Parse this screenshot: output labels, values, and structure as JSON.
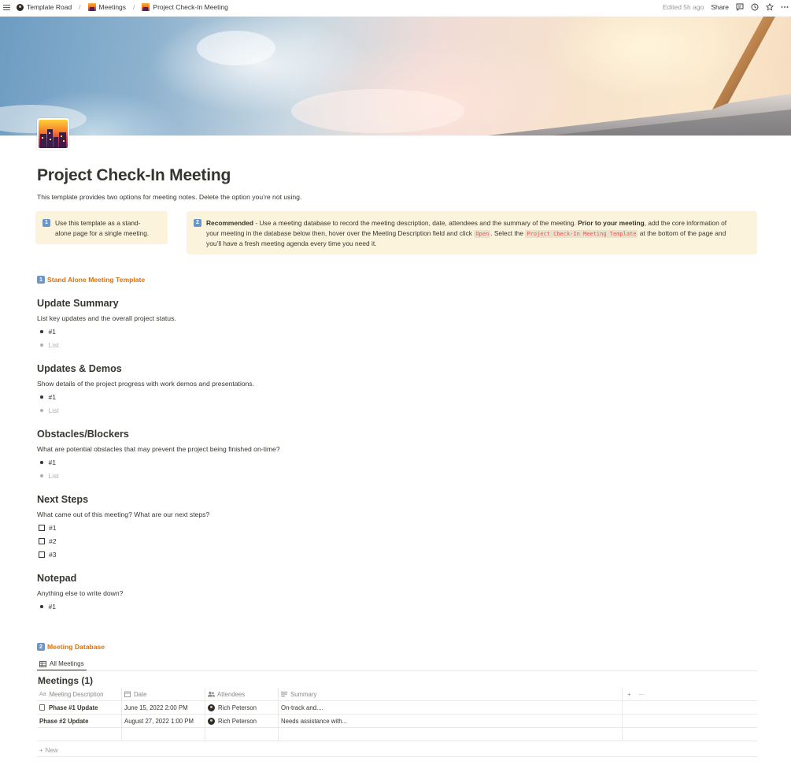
{
  "breadcrumb": {
    "items": [
      "Template Road",
      "Meetings",
      "Project Check-In Meeting"
    ],
    "separator": "/"
  },
  "topbar": {
    "edited": "Edited 5h ago",
    "share_label": "Share",
    "icons": [
      "comment-icon",
      "history-icon",
      "star-icon",
      "more-icon"
    ]
  },
  "page": {
    "title": "Project Check-In Meeting",
    "intro": "This template provides two options for meeting notes. Delete the option you’re not using."
  },
  "callouts": {
    "one": {
      "badge": "1",
      "line1": "Use this template as a stand-",
      "line2": "alone page for a single meeting."
    },
    "two": {
      "badge": "2",
      "rec_bold": "Recommended",
      "l1a": " - Use a meeting database to record the meeting description, date, attendees and the summary of the meeting. ",
      "l1b": "Prior to your meeting",
      "l1c": ", add the core information of",
      "l2a": "your meeting in the database below then, hover over the Meeting Description field and click ",
      "l2code": "Open",
      "l2b": ". Select the ",
      "l2code2": "Project Check-In Meeting Template",
      "l2c": " at the bottom of the page and",
      "l3": "you’ll have a fresh meeting agenda every time you need it."
    }
  },
  "sections": {
    "standalone": {
      "badge": "1",
      "label": "Stand Alone Meeting Template"
    },
    "database": {
      "badge": "2",
      "label": "Meeting Database"
    }
  },
  "update_summary": {
    "heading": "Update Summary",
    "desc": "List key updates and the overall project status.",
    "bullets": [
      "#1"
    ],
    "placeholder": "List"
  },
  "updates_demos": {
    "heading": "Updates & Demos",
    "desc": "Show details of the project progress with work demos and presentations.",
    "bullets": [
      "#1"
    ],
    "placeholder": "List"
  },
  "obstacles": {
    "heading": "Obstacles/Blockers",
    "desc": "What are potential obstacles that may prevent the project being finished on-time?",
    "bullets": [
      "#1"
    ],
    "placeholder": "List"
  },
  "next_steps": {
    "heading": "Next Steps",
    "desc": "What came out of this meeting? What are our next steps?",
    "todos": [
      "#1",
      "#2",
      "#3"
    ]
  },
  "notepad": {
    "heading": "Notepad",
    "desc": "Anything else to write down?",
    "bullets": [
      "#1"
    ]
  },
  "database": {
    "view_tab": "All Meetings",
    "title": "Meetings (1)",
    "columns": [
      "Meeting Description",
      "Date",
      "Attendees",
      "Summary"
    ],
    "rows": [
      {
        "description": "Phase #1 Update",
        "date": "June 15, 2022 2:00 PM",
        "attendee": "Rich Peterson",
        "summary": "On-track and...."
      },
      {
        "description": "Phase #2 Update",
        "date": "August 27, 2022 1:00 PM",
        "attendee": "Rich Peterson",
        "summary": "Needs assistance with..."
      }
    ],
    "new_label": "New",
    "add_icon": "+",
    "more_icon": "···"
  },
  "colors": {
    "text": "#37352f",
    "callout_bg": "#fbf3db",
    "section_link": "#d9730d",
    "badge_blue": "#6b96c8",
    "code_red": "#eb5757"
  }
}
